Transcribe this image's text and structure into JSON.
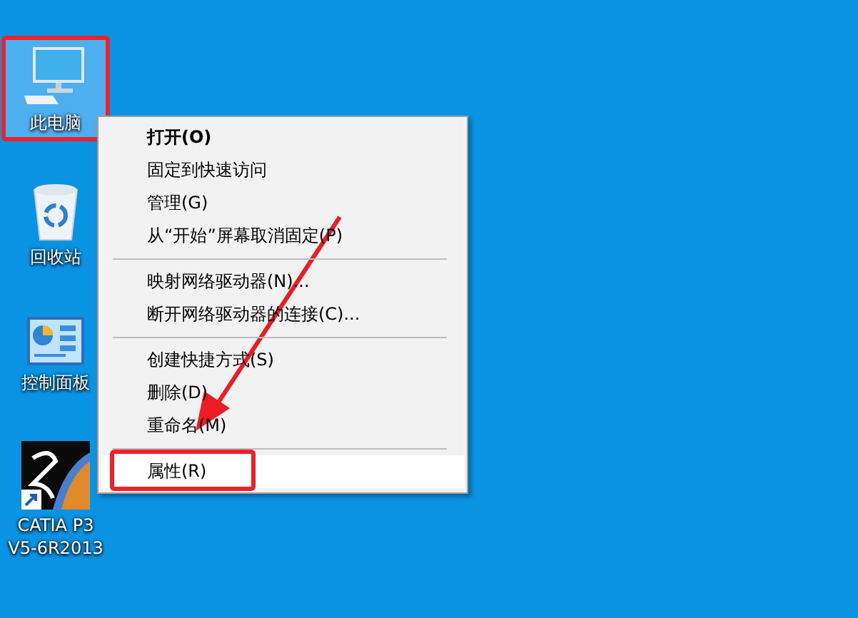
{
  "desktop_icons": [
    {
      "label": "此电脑",
      "kind": "computer",
      "selected": true,
      "annotated": true
    },
    {
      "label": "回收站",
      "kind": "recycle",
      "selected": false,
      "annotated": false
    },
    {
      "label": "控制面板",
      "kind": "control",
      "selected": false,
      "annotated": false
    },
    {
      "label": "CATIA P3 V5-6R2013",
      "kind": "catia",
      "selected": false,
      "annotated": false
    }
  ],
  "context_menu": {
    "items": [
      {
        "kind": "item",
        "label": "打开(O)",
        "bold": true,
        "selected": false,
        "annotated": false
      },
      {
        "kind": "item",
        "label": "固定到快速访问",
        "bold": false,
        "selected": false,
        "annotated": false
      },
      {
        "kind": "item",
        "label": "管理(G)",
        "bold": false,
        "selected": false,
        "annotated": false
      },
      {
        "kind": "item",
        "label": "从“开始”屏幕取消固定(P)",
        "bold": false,
        "selected": false,
        "annotated": false
      },
      {
        "kind": "separator"
      },
      {
        "kind": "item",
        "label": "映射网络驱动器(N)...",
        "bold": false,
        "selected": false,
        "annotated": false
      },
      {
        "kind": "item",
        "label": "断开网络驱动器的连接(C)...",
        "bold": false,
        "selected": false,
        "annotated": false
      },
      {
        "kind": "separator"
      },
      {
        "kind": "item",
        "label": "创建快捷方式(S)",
        "bold": false,
        "selected": false,
        "annotated": false
      },
      {
        "kind": "item",
        "label": "删除(D)",
        "bold": false,
        "selected": false,
        "annotated": false
      },
      {
        "kind": "item",
        "label": "重命名(M)",
        "bold": false,
        "selected": false,
        "annotated": false
      },
      {
        "kind": "separator"
      },
      {
        "kind": "item",
        "label": "属性(R)",
        "bold": false,
        "selected": true,
        "annotated": true
      }
    ]
  }
}
